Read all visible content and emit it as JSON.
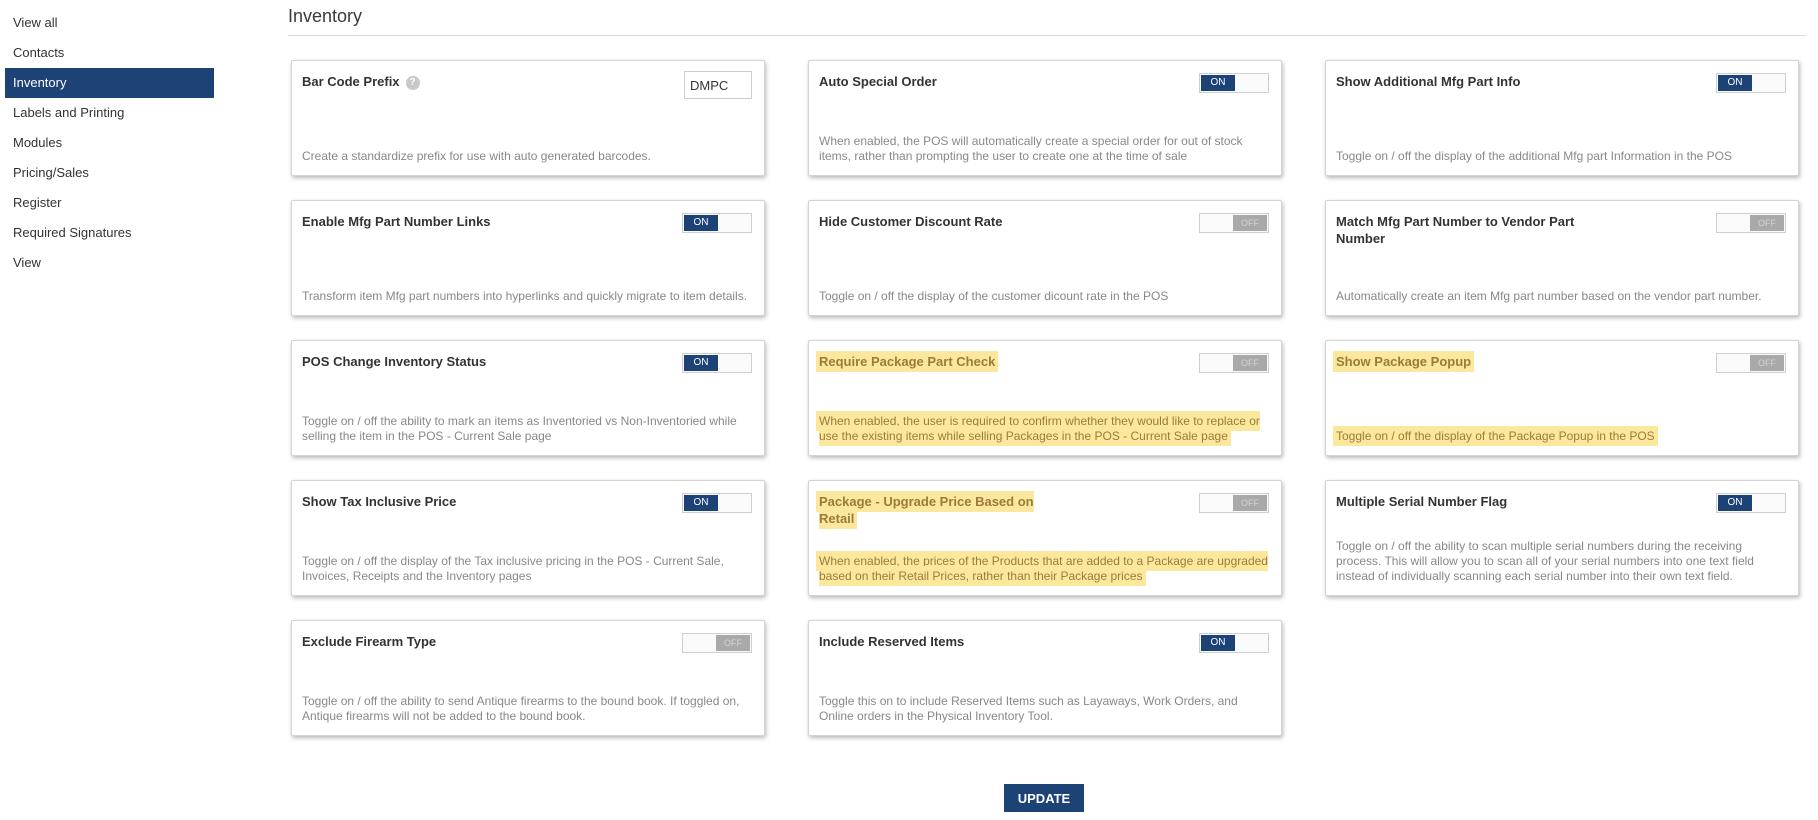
{
  "sidebar": {
    "items": [
      {
        "label": "View all"
      },
      {
        "label": "Contacts"
      },
      {
        "label": "Inventory"
      },
      {
        "label": "Labels and Printing"
      },
      {
        "label": "Modules"
      },
      {
        "label": "Pricing/Sales"
      },
      {
        "label": "Register"
      },
      {
        "label": "Required Signatures"
      },
      {
        "label": "View"
      }
    ],
    "active": "Inventory"
  },
  "page": {
    "title": "Inventory"
  },
  "settings": [
    {
      "title": "Bar Code Prefix",
      "control": "input",
      "value": "DMPC",
      "help_icon": "question-circle-icon",
      "desc": "Create a standardize prefix for use with auto generated barcodes.",
      "highlighted": false
    },
    {
      "title": "Auto Special Order",
      "control": "toggle",
      "state": "ON",
      "desc": "When enabled, the POS will automatically create a special order for out of stock items, rather than prompting the user to create one at the time of sale",
      "highlighted": false
    },
    {
      "title": "Show Additional Mfg Part Info",
      "control": "toggle",
      "state": "ON",
      "desc": "Toggle on / off the display of the additional Mfg part Information in the POS",
      "highlighted": false
    },
    {
      "title": "Enable Mfg Part Number Links",
      "control": "toggle",
      "state": "ON",
      "desc": "Transform item Mfg part numbers into hyperlinks and quickly migrate to item details.",
      "highlighted": false
    },
    {
      "title": "Hide Customer Discount Rate",
      "control": "toggle",
      "state": "OFF",
      "desc": "Toggle on / off the display of the customer dicount rate in the POS",
      "highlighted": false
    },
    {
      "title": "Match Mfg Part Number to Vendor Part Number",
      "control": "toggle",
      "state": "OFF",
      "desc": "Automatically create an item Mfg part number based on the vendor part number.",
      "highlighted": false
    },
    {
      "title": "POS Change Inventory Status",
      "control": "toggle",
      "state": "ON",
      "desc": "Toggle on / off the ability to mark an items as Inventoried vs Non-Inventoried while selling the item in the POS - Current Sale page",
      "highlighted": false
    },
    {
      "title": "Require Package Part Check",
      "control": "toggle",
      "state": "OFF",
      "desc": "When enabled, the user is required to confirm whether they would like to replace or use the existing items while selling Packages in the POS - Current Sale page",
      "highlighted": true
    },
    {
      "title": "Show Package Popup",
      "control": "toggle",
      "state": "OFF",
      "desc": "Toggle on / off the display of the Package Popup in the POS",
      "highlighted": true
    },
    {
      "title": "Show Tax Inclusive Price",
      "control": "toggle",
      "state": "ON",
      "desc": "Toggle on / off the display of the Tax inclusive pricing in the POS - Current Sale, Invoices, Receipts and the Inventory pages",
      "highlighted": false
    },
    {
      "title": "Package - Upgrade Price Based on Retail",
      "control": "toggle",
      "state": "OFF",
      "desc": "When enabled, the prices of the Products that are added to a Package are upgraded based on their Retail Prices, rather than their Package prices",
      "highlighted": true
    },
    {
      "title": "Multiple Serial Number Flag",
      "control": "toggle",
      "state": "ON",
      "desc": "Toggle on / off the ability to scan multiple serial numbers during the receiving process. This will allow you to scan all of your serial numbers into one text field instead of individually scanning each serial number into their own text field.",
      "highlighted": false
    },
    {
      "title": "Exclude Firearm Type",
      "control": "toggle",
      "state": "OFF",
      "desc": "Toggle on / off the ability to send Antique firearms to the bound book. If toggled on, Antique firearms will not be added to the bound book.",
      "highlighted": false
    },
    {
      "title": "Include Reserved Items",
      "control": "toggle",
      "state": "ON",
      "desc": "Toggle this on to include Reserved Items such as Layaways, Work Orders, and Online orders in the Physical Inventory Tool.",
      "highlighted": false
    }
  ],
  "actions": {
    "update_label": "UPDATE"
  },
  "colors": {
    "accent": "#1d4275",
    "highlight": "#fce89c",
    "toggle_off": "#a9a9a9"
  }
}
